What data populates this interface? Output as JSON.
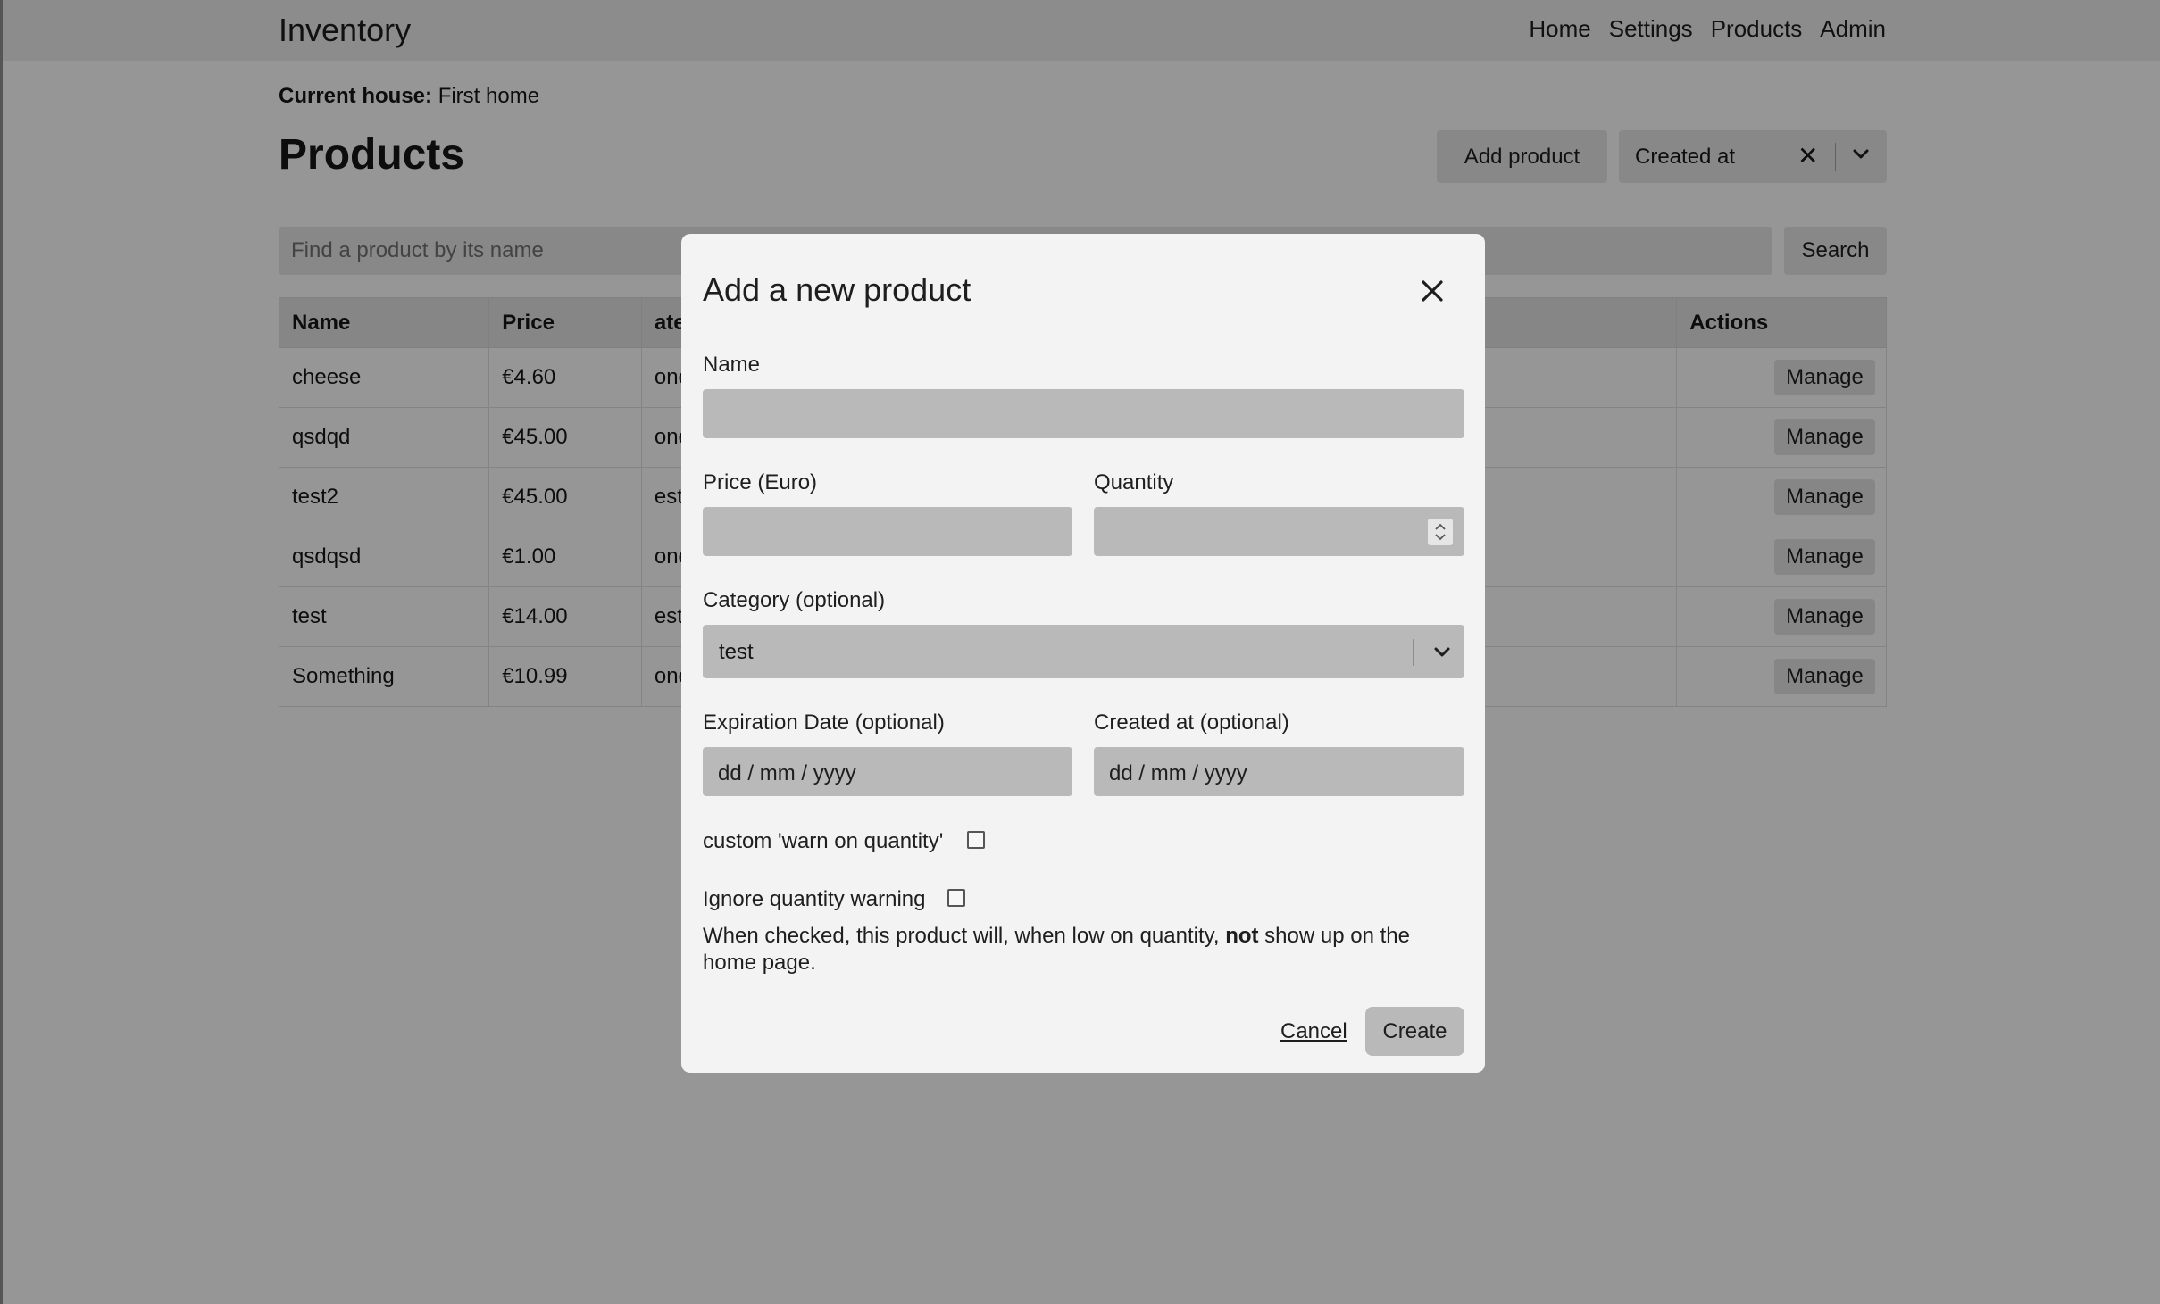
{
  "navbar": {
    "brand": "Inventory",
    "links": [
      "Home",
      "Settings",
      "Products",
      "Admin"
    ]
  },
  "house": {
    "label": "Current house:",
    "value": "First home"
  },
  "page_title": "Products",
  "toolbar": {
    "add_label": "Add product",
    "sort_value": "Created at",
    "clear_icon": "close-icon",
    "dropdown_icon": "chevron-down-icon"
  },
  "search": {
    "placeholder": "Find a product by its name",
    "button_label": "Search"
  },
  "table": {
    "headers": [
      "Name",
      "Price",
      "ategory",
      "Actions"
    ],
    "rows": [
      {
        "name": "cheese",
        "price": "€4.60",
        "category": "one",
        "action": "Manage"
      },
      {
        "name": "qsdqd",
        "price": "€45.00",
        "category": "one",
        "action": "Manage"
      },
      {
        "name": "test2",
        "price": "€45.00",
        "category": "est",
        "action": "Manage"
      },
      {
        "name": "qsdqsd",
        "price": "€1.00",
        "category": "one",
        "action": "Manage"
      },
      {
        "name": "test",
        "price": "€14.00",
        "category": "est",
        "action": "Manage"
      },
      {
        "name": "Something",
        "price": "€10.99",
        "category": "one",
        "action": "Manage"
      }
    ]
  },
  "modal": {
    "title": "Add a new product",
    "close_icon": "close-icon",
    "name_label": "Name",
    "name_value": "",
    "price_label": "Price (Euro)",
    "price_value": "",
    "quantity_label": "Quantity",
    "quantity_value": "",
    "category_label": "Category (optional)",
    "category_value": "test",
    "expiration_label": "Expiration Date (optional)",
    "expiration_placeholder": "dd / mm / yyyy",
    "created_label": "Created at (optional)",
    "created_placeholder": "dd / mm / yyyy",
    "warn_label": "custom 'warn on quantity'",
    "warn_checked": false,
    "ignore_label": "Ignore quantity warning",
    "ignore_checked": false,
    "help_before": "When checked, this product will, when low on quantity, ",
    "help_bold": "not",
    "help_after": " show up on the home page.",
    "cancel_label": "Cancel",
    "create_label": "Create"
  }
}
